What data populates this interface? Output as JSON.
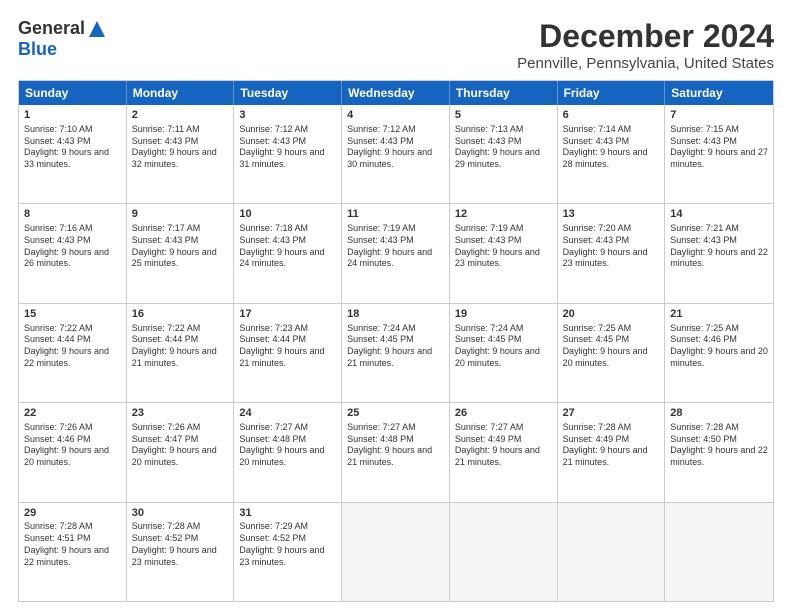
{
  "header": {
    "logo_general": "General",
    "logo_blue": "Blue",
    "title": "December 2024",
    "subtitle": "Pennville, Pennsylvania, United States"
  },
  "days_of_week": [
    "Sunday",
    "Monday",
    "Tuesday",
    "Wednesday",
    "Thursday",
    "Friday",
    "Saturday"
  ],
  "weeks": [
    [
      {
        "day": "1",
        "rise": "Sunrise: 7:10 AM",
        "set": "Sunset: 4:43 PM",
        "daylight": "Daylight: 9 hours and 33 minutes."
      },
      {
        "day": "2",
        "rise": "Sunrise: 7:11 AM",
        "set": "Sunset: 4:43 PM",
        "daylight": "Daylight: 9 hours and 32 minutes."
      },
      {
        "day": "3",
        "rise": "Sunrise: 7:12 AM",
        "set": "Sunset: 4:43 PM",
        "daylight": "Daylight: 9 hours and 31 minutes."
      },
      {
        "day": "4",
        "rise": "Sunrise: 7:12 AM",
        "set": "Sunset: 4:43 PM",
        "daylight": "Daylight: 9 hours and 30 minutes."
      },
      {
        "day": "5",
        "rise": "Sunrise: 7:13 AM",
        "set": "Sunset: 4:43 PM",
        "daylight": "Daylight: 9 hours and 29 minutes."
      },
      {
        "day": "6",
        "rise": "Sunrise: 7:14 AM",
        "set": "Sunset: 4:43 PM",
        "daylight": "Daylight: 9 hours and 28 minutes."
      },
      {
        "day": "7",
        "rise": "Sunrise: 7:15 AM",
        "set": "Sunset: 4:43 PM",
        "daylight": "Daylight: 9 hours and 27 minutes."
      }
    ],
    [
      {
        "day": "8",
        "rise": "Sunrise: 7:16 AM",
        "set": "Sunset: 4:43 PM",
        "daylight": "Daylight: 9 hours and 26 minutes."
      },
      {
        "day": "9",
        "rise": "Sunrise: 7:17 AM",
        "set": "Sunset: 4:43 PM",
        "daylight": "Daylight: 9 hours and 25 minutes."
      },
      {
        "day": "10",
        "rise": "Sunrise: 7:18 AM",
        "set": "Sunset: 4:43 PM",
        "daylight": "Daylight: 9 hours and 24 minutes."
      },
      {
        "day": "11",
        "rise": "Sunrise: 7:19 AM",
        "set": "Sunset: 4:43 PM",
        "daylight": "Daylight: 9 hours and 24 minutes."
      },
      {
        "day": "12",
        "rise": "Sunrise: 7:19 AM",
        "set": "Sunset: 4:43 PM",
        "daylight": "Daylight: 9 hours and 23 minutes."
      },
      {
        "day": "13",
        "rise": "Sunrise: 7:20 AM",
        "set": "Sunset: 4:43 PM",
        "daylight": "Daylight: 9 hours and 23 minutes."
      },
      {
        "day": "14",
        "rise": "Sunrise: 7:21 AM",
        "set": "Sunset: 4:43 PM",
        "daylight": "Daylight: 9 hours and 22 minutes."
      }
    ],
    [
      {
        "day": "15",
        "rise": "Sunrise: 7:22 AM",
        "set": "Sunset: 4:44 PM",
        "daylight": "Daylight: 9 hours and 22 minutes."
      },
      {
        "day": "16",
        "rise": "Sunrise: 7:22 AM",
        "set": "Sunset: 4:44 PM",
        "daylight": "Daylight: 9 hours and 21 minutes."
      },
      {
        "day": "17",
        "rise": "Sunrise: 7:23 AM",
        "set": "Sunset: 4:44 PM",
        "daylight": "Daylight: 9 hours and 21 minutes."
      },
      {
        "day": "18",
        "rise": "Sunrise: 7:24 AM",
        "set": "Sunset: 4:45 PM",
        "daylight": "Daylight: 9 hours and 21 minutes."
      },
      {
        "day": "19",
        "rise": "Sunrise: 7:24 AM",
        "set": "Sunset: 4:45 PM",
        "daylight": "Daylight: 9 hours and 20 minutes."
      },
      {
        "day": "20",
        "rise": "Sunrise: 7:25 AM",
        "set": "Sunset: 4:45 PM",
        "daylight": "Daylight: 9 hours and 20 minutes."
      },
      {
        "day": "21",
        "rise": "Sunrise: 7:25 AM",
        "set": "Sunset: 4:46 PM",
        "daylight": "Daylight: 9 hours and 20 minutes."
      }
    ],
    [
      {
        "day": "22",
        "rise": "Sunrise: 7:26 AM",
        "set": "Sunset: 4:46 PM",
        "daylight": "Daylight: 9 hours and 20 minutes."
      },
      {
        "day": "23",
        "rise": "Sunrise: 7:26 AM",
        "set": "Sunset: 4:47 PM",
        "daylight": "Daylight: 9 hours and 20 minutes."
      },
      {
        "day": "24",
        "rise": "Sunrise: 7:27 AM",
        "set": "Sunset: 4:48 PM",
        "daylight": "Daylight: 9 hours and 20 minutes."
      },
      {
        "day": "25",
        "rise": "Sunrise: 7:27 AM",
        "set": "Sunset: 4:48 PM",
        "daylight": "Daylight: 9 hours and 21 minutes."
      },
      {
        "day": "26",
        "rise": "Sunrise: 7:27 AM",
        "set": "Sunset: 4:49 PM",
        "daylight": "Daylight: 9 hours and 21 minutes."
      },
      {
        "day": "27",
        "rise": "Sunrise: 7:28 AM",
        "set": "Sunset: 4:49 PM",
        "daylight": "Daylight: 9 hours and 21 minutes."
      },
      {
        "day": "28",
        "rise": "Sunrise: 7:28 AM",
        "set": "Sunset: 4:50 PM",
        "daylight": "Daylight: 9 hours and 22 minutes."
      }
    ],
    [
      {
        "day": "29",
        "rise": "Sunrise: 7:28 AM",
        "set": "Sunset: 4:51 PM",
        "daylight": "Daylight: 9 hours and 22 minutes."
      },
      {
        "day": "30",
        "rise": "Sunrise: 7:28 AM",
        "set": "Sunset: 4:52 PM",
        "daylight": "Daylight: 9 hours and 23 minutes."
      },
      {
        "day": "31",
        "rise": "Sunrise: 7:29 AM",
        "set": "Sunset: 4:52 PM",
        "daylight": "Daylight: 9 hours and 23 minutes."
      },
      null,
      null,
      null,
      null
    ]
  ]
}
